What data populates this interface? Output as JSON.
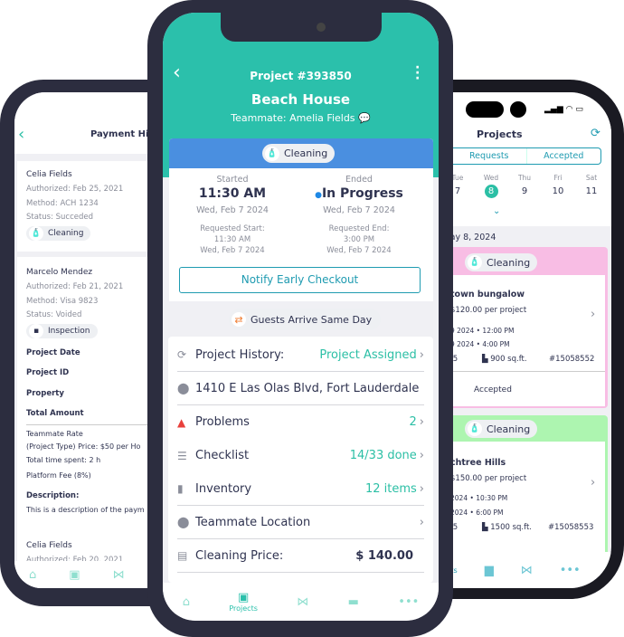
{
  "colors": {
    "teal": "#2bc0ab",
    "blue_band": "#4a8fe0",
    "pink": "#f8bde4",
    "green": "#adf5b0",
    "frame": "#2c2d3f",
    "warning": "#e8413c"
  },
  "left": {
    "title": "Payment His",
    "payments": [
      {
        "name": "Celia Fields",
        "authorized": "Authorized: Feb 25, 2021",
        "method": "Method: ACH 1234",
        "status": "Status: Succeded",
        "tag": "Cleaning",
        "tag_icon": "spray-bottle-icon"
      },
      {
        "name": "Marcelo Mendez",
        "authorized": "Authorized: Feb 21, 2021",
        "method": "Method: Visa 9823",
        "status": "Status: Voided",
        "tag": "Inspection",
        "tag_icon": "clipboard-icon"
      }
    ],
    "details": [
      "Project Date",
      "Project ID",
      "Property",
      "Total Amount"
    ],
    "rate": {
      "title": "Teammate Rate",
      "price": "(Project Type) Price: $50 per Ho",
      "time": "Total time spent: 2 h",
      "fee": "Platform Fee (8%)"
    },
    "description_label": "Description:",
    "description": "This is a description of the paym",
    "next": {
      "name": "Celia Fields",
      "authorized": "Authorized: Feb 20, 2021"
    },
    "nav": [
      "home-icon",
      "calendar-icon",
      "handshake-icon"
    ]
  },
  "center": {
    "project_id": "Project #393850",
    "property": "Beach House",
    "teammate": "Teammate: Amelia Fields",
    "type": "Cleaning",
    "started_label": "Started",
    "started_time": "11:30 AM",
    "started_date": "Wed, Feb 7 2024",
    "ended_label": "Ended",
    "ended_status": "In Progress",
    "ended_date": "Wed, Feb 7 2024",
    "req_start_label": "Requested Start:",
    "req_start_time": "11:30 AM",
    "req_start_date": "Wed, Feb 7 2024",
    "req_end_label": "Requested End:",
    "req_end_time": "3:00 PM",
    "req_end_date": "Wed, Feb 7 2024",
    "notify_button": "Notify Early Checkout",
    "guests_badge": "Guests Arrive Same Day",
    "rows": [
      {
        "icon": "history-icon",
        "glyph": "⟳",
        "label": "Project History:",
        "value": "Project Assigned",
        "chevron": true
      },
      {
        "icon": "location-pin-icon",
        "glyph": "⬤",
        "label": "1410 E Las Olas Blvd, Fort Lauderdale",
        "value": "",
        "chevron": false
      },
      {
        "icon": "warning-icon",
        "glyph": "▲",
        "label": "Problems",
        "value": "2",
        "chevron": true
      },
      {
        "icon": "checklist-icon",
        "glyph": "☰",
        "label": "Checklist",
        "value": "14/33 done",
        "chevron": true
      },
      {
        "icon": "inventory-icon",
        "glyph": "▮",
        "label": "Inventory",
        "value": "12 items",
        "chevron": true
      },
      {
        "icon": "location-pin-icon",
        "glyph": "⬤",
        "label": "Teammate Location",
        "value": "",
        "chevron": true
      },
      {
        "icon": "price-icon",
        "glyph": "▤",
        "label": "Cleaning Price:",
        "value": "$ 140.00",
        "chevron": false
      }
    ],
    "nav": [
      {
        "icon": "home-icon",
        "label": ""
      },
      {
        "icon": "calendar-icon",
        "label": "Projects",
        "active": true
      },
      {
        "icon": "handshake-icon",
        "label": ""
      },
      {
        "icon": "card-icon",
        "label": ""
      },
      {
        "icon": "more-icon",
        "label": ""
      }
    ]
  },
  "right": {
    "title": "Projects",
    "tabs": [
      "Requests",
      "Accepted"
    ],
    "days": [
      {
        "d": "Tue",
        "n": "7"
      },
      {
        "d": "Wed",
        "n": "8",
        "selected": true
      },
      {
        "d": "Thu",
        "n": "9"
      },
      {
        "d": "Fri",
        "n": "10"
      },
      {
        "d": "Sat",
        "n": "11"
      }
    ],
    "date_header": "lay 8, 2024",
    "cards": [
      {
        "type": "Cleaning",
        "color": "pink",
        "name": "town bungalow",
        "price": "$120.00",
        "price_unit": "per project",
        "start": "9 2024 • 12:00 PM",
        "end": "9 2024 • 4:00 PM",
        "baths": ".5",
        "size": "900 sq.ft.",
        "id": "#15058552",
        "status": "Accepted"
      },
      {
        "type": "Cleaning",
        "color": "green",
        "name": "chtree Hills",
        "price": "$150.00",
        "price_unit": "per project",
        "start": "2024 • 10:30 PM",
        "end": "2024 • 6:00 PM",
        "baths": ".5",
        "size": "1500 sq.ft.",
        "id": "#15058553"
      }
    ],
    "nav_label": "cts"
  }
}
